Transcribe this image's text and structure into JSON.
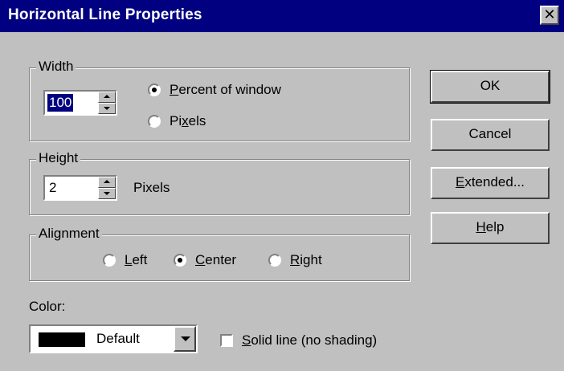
{
  "window": {
    "title": "Horizontal Line Properties",
    "close_glyph": "✕"
  },
  "width": {
    "group_label": "Width",
    "value": "100",
    "options": [
      {
        "label": "Percent of window",
        "accel": "P",
        "checked": true
      },
      {
        "label": "Pixels",
        "accel": "x",
        "checked": false
      }
    ]
  },
  "height": {
    "group_label": "Height",
    "value": "2",
    "unit": "Pixels"
  },
  "alignment": {
    "group_label": "Alignment",
    "options": [
      {
        "label": "Left",
        "accel": "L",
        "checked": false
      },
      {
        "label": "Center",
        "accel": "C",
        "checked": true
      },
      {
        "label": "Right",
        "accel": "R",
        "checked": false
      }
    ]
  },
  "color": {
    "label": "Color:",
    "value": "Default",
    "swatch": "#000000"
  },
  "solid_line": {
    "label": "Solid line (no shading)",
    "accel": "S",
    "checked": false
  },
  "buttons": {
    "ok": "OK",
    "cancel": "Cancel",
    "extended": "Extended...",
    "help": "Help"
  }
}
